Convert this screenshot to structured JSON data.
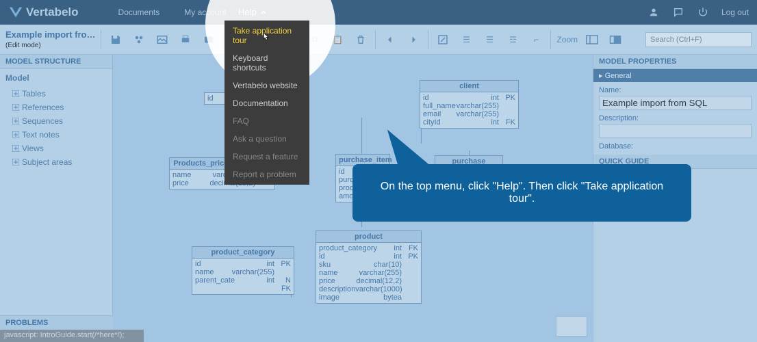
{
  "brand": "Vertabelo",
  "topnav": {
    "documents": "Documents",
    "my_account": "My account",
    "help": "Help",
    "logout": "Log out"
  },
  "doc": {
    "title": "Example import fro…",
    "mode": "(Edit mode)"
  },
  "search": {
    "placeholder": "Search (Ctrl+F)"
  },
  "zoom_label": "Zoom",
  "left": {
    "head": "MODEL STRUCTURE",
    "root": "Model",
    "items": [
      "Tables",
      "References",
      "Sequences",
      "Text notes",
      "Views",
      "Subject areas"
    ]
  },
  "right": {
    "head": "MODEL PROPERTIES",
    "sub": "General",
    "name_label": "Name:",
    "name_value": "Example import from SQL",
    "desc_label": "Description:",
    "db_label": "Database:",
    "quick": "QUICK GUIDE"
  },
  "help_menu": [
    "Take application tour",
    "Keyboard shortcuts",
    "Vertabelo website",
    "Documentation",
    "FAQ",
    "Ask a question",
    "Request a feature",
    "Report a problem"
  ],
  "callout": "On the top menu, click \"Help\". Then click \"Take application tour\".",
  "problems": "PROBLEMS",
  "status": "javascript: IntroGuide.start(/*here*/);",
  "entities": {
    "e0": {
      "head": "",
      "rows": [
        [
          "id",
          "",
          ""
        ]
      ]
    },
    "e1": {
      "head": "client",
      "rows": [
        [
          "id",
          "int",
          "PK"
        ],
        [
          "full_name",
          "varchar(255)",
          ""
        ],
        [
          "email",
          "varchar(255)",
          ""
        ],
        [
          "cityId",
          "int",
          "FK"
        ]
      ]
    },
    "e2": {
      "head": "Products_price_above_150",
      "rows": [
        [
          "name",
          "varchar(255)",
          ""
        ],
        [
          "price",
          "decimal(12,2)",
          ""
        ]
      ]
    },
    "e3": {
      "head": "purchase_item",
      "rows": [
        [
          "id",
          "",
          ""
        ],
        [
          "purc",
          "",
          ""
        ],
        [
          "prod",
          "",
          ""
        ],
        [
          "amo",
          "",
          ""
        ]
      ]
    },
    "e4": {
      "head": "purchase",
      "rows": []
    },
    "e5": {
      "head": "product_category",
      "rows": [
        [
          "id",
          "int",
          "PK"
        ],
        [
          "name",
          "varchar(255)",
          ""
        ],
        [
          "parent_cate",
          "int",
          "N FK"
        ]
      ]
    },
    "e6": {
      "head": "product",
      "rows": [
        [
          "product_category",
          "int",
          "FK"
        ],
        [
          "id",
          "int",
          "PK"
        ],
        [
          "sku",
          "char(10)",
          ""
        ],
        [
          "name",
          "varchar(255)",
          ""
        ],
        [
          "price",
          "decimal(12,2)",
          ""
        ],
        [
          "description",
          "varchar(1000)",
          ""
        ],
        [
          "image",
          "bytea",
          ""
        ]
      ]
    }
  }
}
